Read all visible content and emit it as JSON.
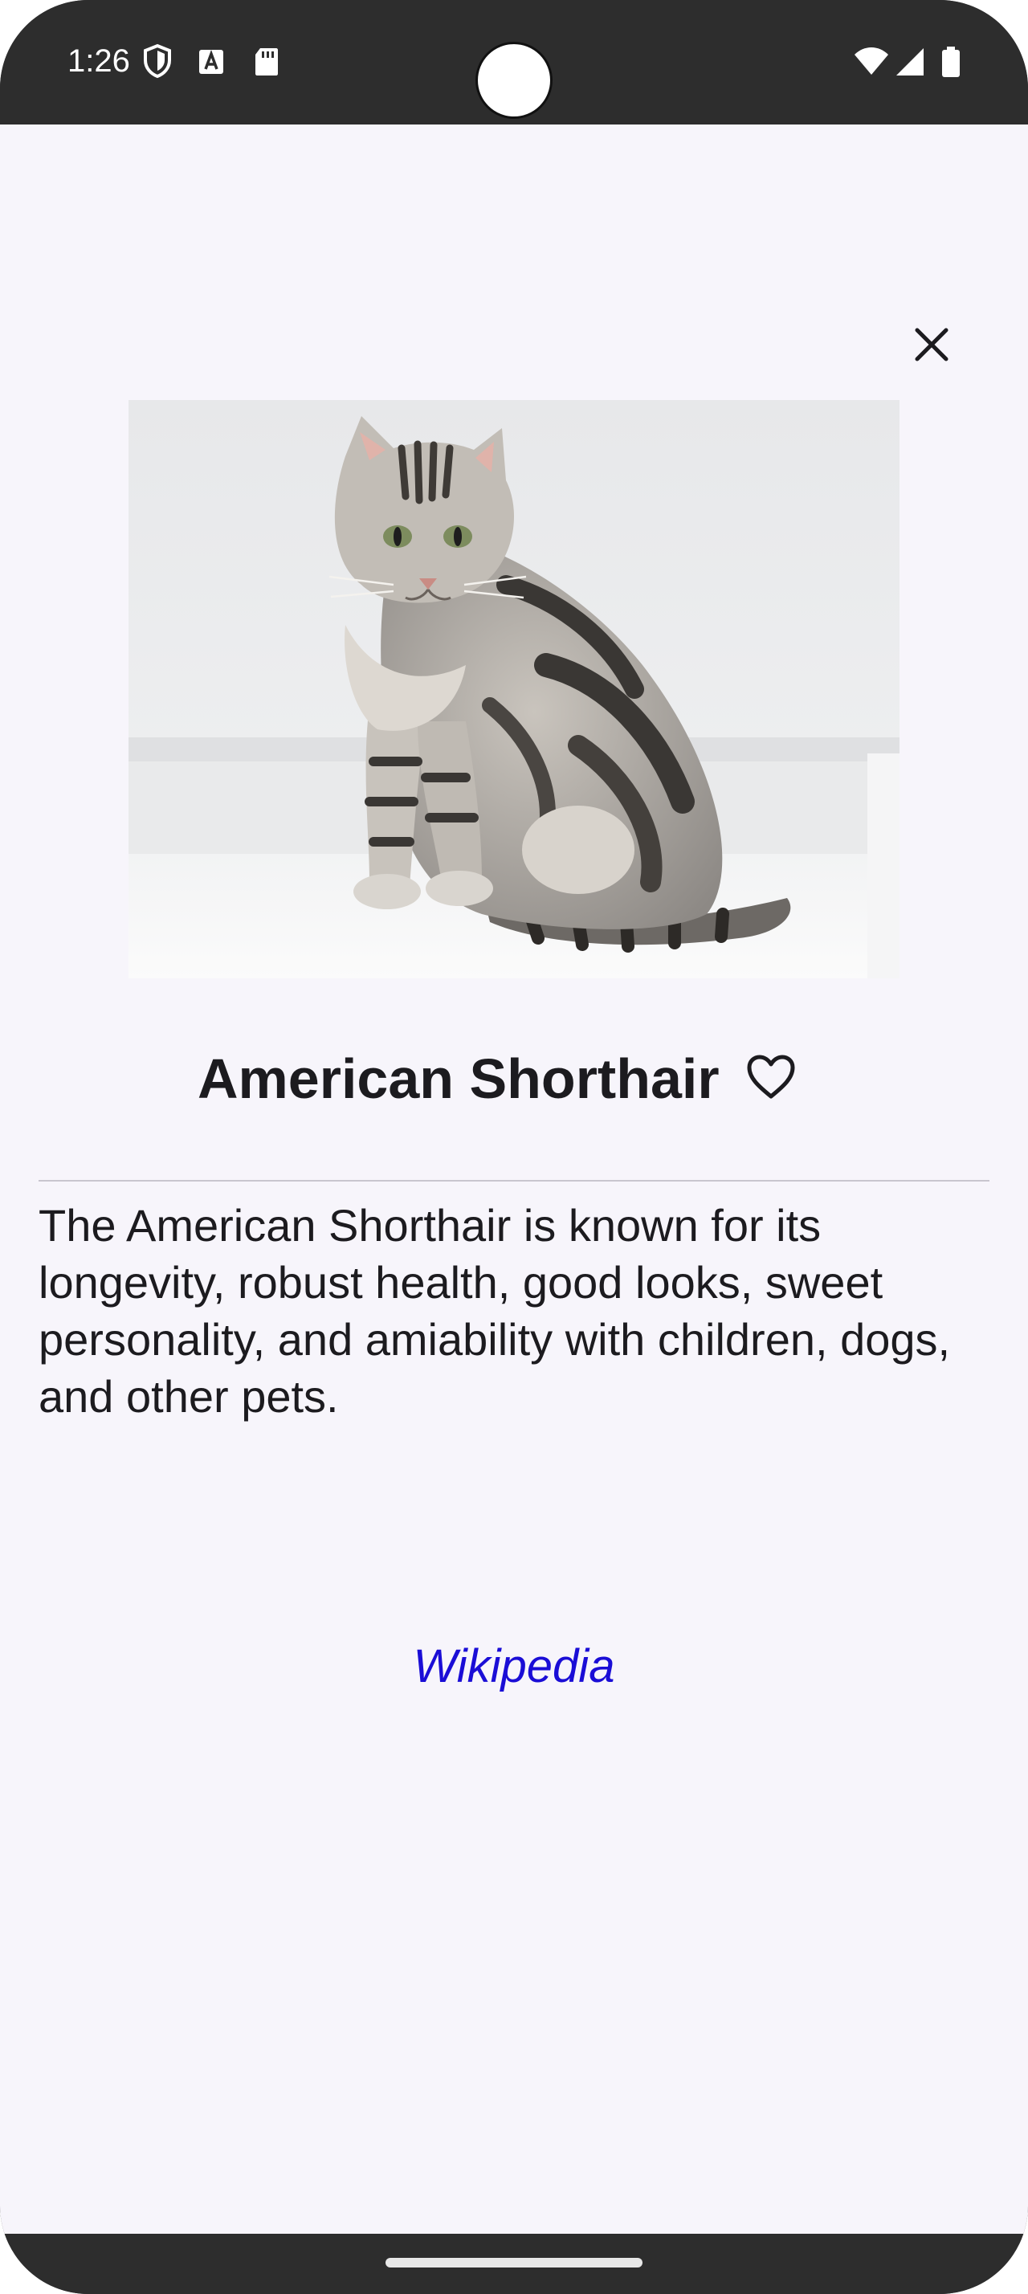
{
  "status_bar": {
    "time": "1:26",
    "icons": [
      "shield-icon",
      "text-a-icon",
      "sd-card-icon",
      "wifi-icon",
      "signal-icon",
      "battery-icon"
    ]
  },
  "detail": {
    "close_icon": "close-icon",
    "image_alt": "American Shorthair cat sitting",
    "title": "American Shorthair",
    "favorite_icon": "heart-outline-icon",
    "description": "The American Shorthair is known for its longevity, robust health, good looks, sweet personality, and amiability with children, dogs, and other pets.",
    "link_label": "Wikipedia"
  },
  "colors": {
    "background": "#f7f5fb",
    "title": "#1c1b1f",
    "link": "#1a0dd6",
    "system_bar": "#2d2d2d"
  }
}
